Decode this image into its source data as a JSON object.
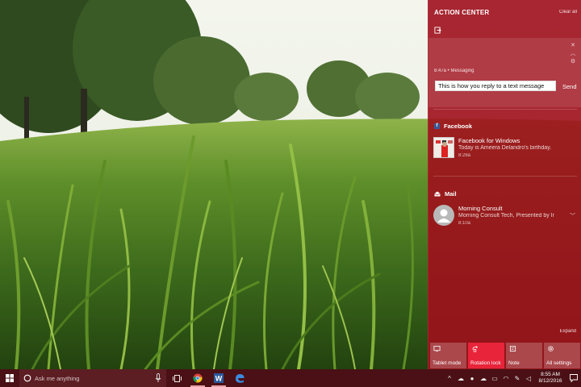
{
  "action_center": {
    "title": "ACTION CENTER",
    "clear_all": "Clear all",
    "message": {
      "source": "8:47a • Messaging",
      "reply_value": "This is how you reply to a text message",
      "send_label": "Send"
    },
    "groups": [
      {
        "name": "Facebook",
        "icon": "facebook-icon",
        "notification": {
          "title": "Facebook for Windows",
          "body": "Today is Ameera Delandro's birthday.",
          "time": "8:28a"
        }
      },
      {
        "name": "Mail",
        "icon": "mail-icon",
        "notification": {
          "title": "Morning Consult",
          "body": "Morning Consult Tech, Presented by Ir",
          "time": "8:10a"
        }
      }
    ],
    "expand_label": "Expand",
    "quick_actions": [
      {
        "label": "Tablet mode",
        "icon": "tablet-mode-icon",
        "active": false
      },
      {
        "label": "Rotation lock",
        "icon": "rotation-lock-icon",
        "active": true
      },
      {
        "label": "Note",
        "icon": "note-icon",
        "active": false
      },
      {
        "label": "All settings",
        "icon": "settings-icon",
        "active": false
      }
    ]
  },
  "taskbar": {
    "search_placeholder": "Ask me anything",
    "pinned_apps": [
      "chrome-icon",
      "word-icon",
      "edge-icon"
    ],
    "clock": {
      "time": "8:55 AM",
      "date": "8/12/2016"
    }
  },
  "colors": {
    "accent": "#9e101c",
    "accent_active": "#e8243a",
    "taskbar": "#4a1015"
  }
}
